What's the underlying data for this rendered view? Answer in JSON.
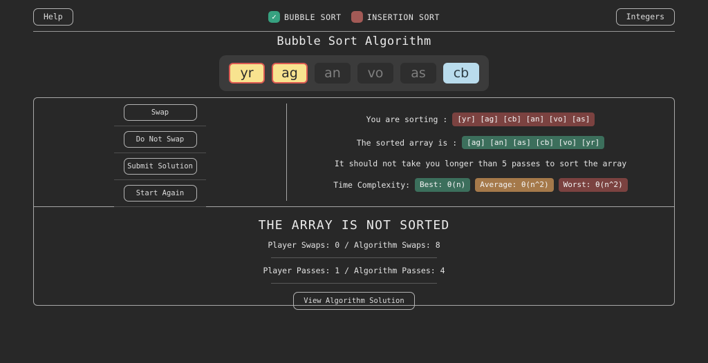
{
  "topbar": {
    "help_label": "Help",
    "datatype_label": "Integers",
    "modes": [
      {
        "label": "BUBBLE SORT",
        "selected": true,
        "icon": "check-icon",
        "color": "#37a180"
      },
      {
        "label": "INSERTION SORT",
        "selected": false,
        "icon": "blank-icon",
        "color": "#a35a56"
      }
    ]
  },
  "title": "Bubble Sort Algorithm",
  "array": {
    "cells": [
      {
        "value": "yr",
        "state": "compare"
      },
      {
        "value": "ag",
        "state": "compare"
      },
      {
        "value": "an",
        "state": "plain"
      },
      {
        "value": "vo",
        "state": "plain"
      },
      {
        "value": "as",
        "state": "plain"
      },
      {
        "value": "cb",
        "state": "sorted"
      }
    ],
    "colors": {
      "compare_bg": "#f8e38f",
      "compare_border": "#dc5a52",
      "plain_bg": "#2e2e2e",
      "sorted_bg": "#b9dced"
    }
  },
  "controls": {
    "buttons": [
      {
        "label": "Swap"
      },
      {
        "label": "Do Not Swap"
      },
      {
        "label": "Submit Solution"
      },
      {
        "label": "Start Again"
      }
    ]
  },
  "info": {
    "sorting_label": "You are sorting :",
    "sorting_value": "[yr] [ag] [cb] [an] [vo] [as]",
    "sorted_label": "The sorted array is :",
    "sorted_value": "[ag] [an] [as] [cb] [vo] [yr]",
    "passes_hint": "It should not take you longer than 5 passes to sort the array",
    "complexity_label": "Time Complexity:",
    "complexity": [
      {
        "text": "Best: θ(n)",
        "tone": "green"
      },
      {
        "text": "Average: θ(n^2)",
        "tone": "tan"
      },
      {
        "text": "Worst: θ(n^2)",
        "tone": "red"
      }
    ]
  },
  "status": {
    "headline": "THE ARRAY IS NOT SORTED",
    "swaps_line": "Player Swaps: 0 / Algorithm Swaps: 8",
    "passes_line": "Player Passes: 1 / Algorithm Passes: 4",
    "solution_button": "View Algorithm Solution"
  }
}
